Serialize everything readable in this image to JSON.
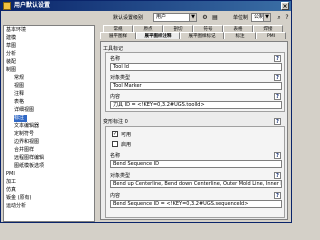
{
  "window": {
    "title": "用户默认设置"
  },
  "toolbar": {
    "scope_label": "默认设置级别",
    "scope_value": "用户",
    "unit_label": "单位制",
    "unit_value": "公制"
  },
  "tree": {
    "items": [
      {
        "label": "基本环境"
      },
      {
        "label": "建模"
      },
      {
        "label": "草图"
      },
      {
        "label": "分析"
      },
      {
        "label": "装配"
      },
      {
        "label": "制图"
      },
      {
        "label": "常规"
      },
      {
        "label": "视图"
      },
      {
        "label": "注释"
      },
      {
        "label": "表格"
      },
      {
        "label": "详细视图"
      },
      {
        "label": "标注"
      },
      {
        "label": "文本编辑器"
      },
      {
        "label": "定制符号"
      },
      {
        "label": "边界和视图"
      },
      {
        "label": "合并图样"
      },
      {
        "label": "远程图样编辑"
      },
      {
        "label": "图纸模板选项"
      },
      {
        "label": "PMI"
      },
      {
        "label": "加工"
      },
      {
        "label": "仿真"
      },
      {
        "label": "钣金 (原有)"
      },
      {
        "label": "运动分析"
      }
    ]
  },
  "tabs": {
    "row1": [
      "常规",
      "原点",
      "剖切",
      "符号",
      "表格",
      "焊接"
    ],
    "row2": [
      "展平图样",
      "展平图样注释",
      "展平图样标记",
      "标注",
      "PMI"
    ]
  },
  "content": {
    "section_label": "工具标记",
    "tool_name_label": "名称",
    "tool_name_value": "Tool Id",
    "tool_obj_label": "对象类型",
    "tool_obj_value": "Tool Marker",
    "tool_content_label": "内容",
    "tool_content_value": "刀具 ID = <!KEY=0,3.2#UGS.toolId>",
    "bend_group_label": "变形标注 0",
    "checkbox_label": "可用",
    "checkbox2_label": "启用",
    "bend_name_label": "名称",
    "bend_name_value": "Bend Sequence ID",
    "bend_obj_label": "对象类型",
    "bend_obj_value": "Bend up Centerline, Bend down Centerline, Outer Mold Line, Inner Mold",
    "bend_content_label": "内容",
    "bend_content_value": "Bend Sequence ID = <!KEY=0,3.2#UGS.sequenceId>",
    "help_symbol": "?"
  }
}
